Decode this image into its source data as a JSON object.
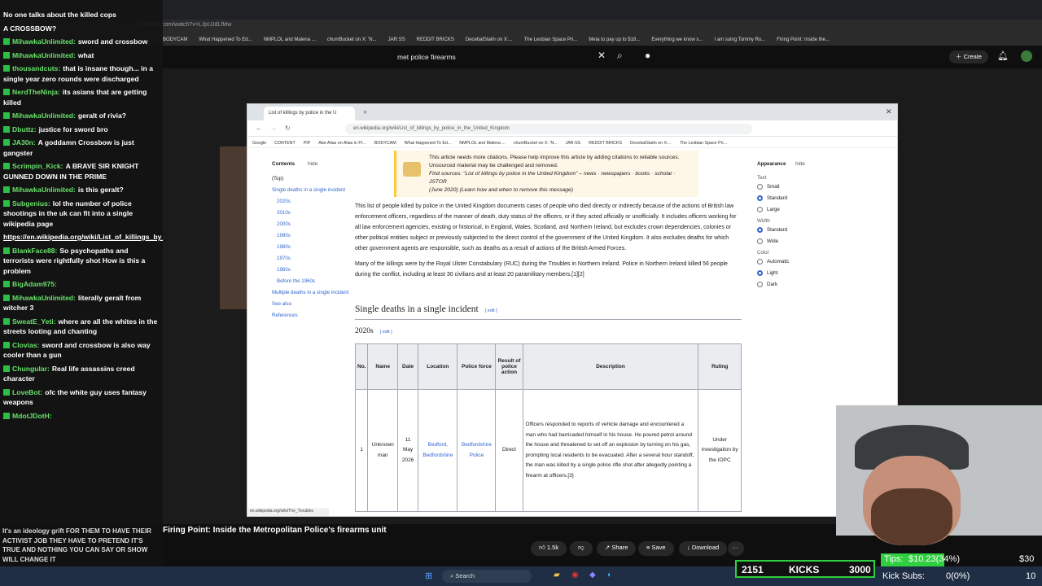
{
  "outer_browser": {
    "url": "youtube.com/watch?v=LJpUJdLfMw",
    "bookmarks": [
      "BODYCAM",
      "What Happened To Ed...",
      "NMPLOL and Malena ...",
      "chumBucket on X: 'N...",
      "JAR:SS",
      "REDDIT BRICKS",
      "DecebalStalin on X:...",
      "The Lesbian Space Pri...",
      "Meta to pay up to $18...",
      "Everything we know s...",
      "I am suing Tommy Ro...",
      "Firing Point: Inside the..."
    ]
  },
  "youtube": {
    "search_query": "met police firearms",
    "create_label": "Create",
    "video_title": "Firing Point: Inside the Metropolitan Police's firearms unit",
    "actions": {
      "likes": "1.5k",
      "share": "Share",
      "save": "Save",
      "download": "Download"
    }
  },
  "chat": {
    "messages": [
      {
        "user": "",
        "text": "No one talks about the killed cops"
      },
      {
        "user": "",
        "text": "A CROSSBOW?"
      },
      {
        "user": "MihawkaUnlimited:",
        "text": "sword and crossbow"
      },
      {
        "user": "MihawkaUnlimited:",
        "text": "what"
      },
      {
        "user": "thousandcuts:",
        "text": "that is insane though... in a single year zero rounds were discharged"
      },
      {
        "user": "NerdTheNinja:",
        "text": "its asians that are getting killed"
      },
      {
        "user": "MihawkaUnlimited:",
        "text": "geralt of rivia?"
      },
      {
        "user": "Dbuttz:",
        "text": "justice for sword bro"
      },
      {
        "user": "JA30n:",
        "text": "A goddamn Crossbow is just gangster"
      },
      {
        "user": "Scrimpin_Kick:",
        "text": "A BRAVE SIR KNIGHT GUNNED DOWN IN THE PRIME"
      },
      {
        "user": "MihawkaUnlimited:",
        "text": "is this geralt?"
      },
      {
        "user": "Subgenius:",
        "text": "lol the number of police shootings in the uk can fit into a single wikipedia page"
      },
      {
        "user": "",
        "text": "https://en.wikipedia.org/wiki/List_of_killings_by_police_in_the_United_Kingdom",
        "link": true
      },
      {
        "user": "BlankFace88:",
        "text": "So psychopaths and terrorists were rightfully shot How is this a problem"
      },
      {
        "user": "BigAdam975:",
        "text": ""
      },
      {
        "user": "MihawkaUnlimited:",
        "text": "literally geralt from witcher 3"
      },
      {
        "user": "SweatE_Yeti:",
        "text": "where are all the whites in the streets looting and chanting"
      },
      {
        "user": "Clovias:",
        "text": "sword and crossbow is also way cooler than a gun"
      },
      {
        "user": "Chungular:",
        "text": "Real life assassins creed character"
      },
      {
        "user": "LoveBot:",
        "text": "ofc the white guy uses fantasy weapons"
      },
      {
        "user": "MdotJDotH:",
        "text": ""
      }
    ],
    "bottom_text": "It's an ideology grift FOR THEM TO HAVE THEIR ACTIVIST JOB THEY HAVE TO PRETEND IT'S TRUE AND NOTHING YOU CAN SAY OR SHOW WILL CHANGE IT"
  },
  "inner_browser": {
    "tab_title": "List of killings by police in the U",
    "url": "en.wikipedia.org/wiki/List_of_killings_by_police_in_the_United_Kingdom",
    "bookmarks": [
      "Google",
      "CONTENT",
      "PIP",
      "Abe Alias on Alias in Pr...",
      "BODYCAM",
      "What Happened To Ed...",
      "NMPLOL and Malena ...",
      "chumBucket on X: 'N...",
      "JAR:SS",
      "REDDIT BRICKS",
      "DecebalStalin on X:...",
      "The Lesbian Space Pri..."
    ],
    "status_url": "en.wikipedia.org/wiki/The_Troubles"
  },
  "wiki": {
    "toc": {
      "title": "Contents",
      "hide": "hide",
      "top": "(Top)",
      "items": [
        "Single deaths in a single incident",
        "2020s",
        "2010s",
        "2000s",
        "1990s",
        "1980s",
        "1970s",
        "1960s",
        "Before the 1960s",
        "Multiple deaths in a single incident",
        "See also",
        "References"
      ]
    },
    "notice": {
      "line1": "This article needs more citations. Please help improve this article by adding citations to reliable sources. Unsourced material may be challenged and removed.",
      "line2": "Find sources: \"List of killings by police in the United Kingdom\" – news · newspapers · books · scholar · JSTOR",
      "line3": "(June 2020) (Learn how and when to remove this message)"
    },
    "intro1": "This list of people killed by police in the United Kingdom documents cases of people who died directly or indirectly because of the actions of British law enforcement officers, regardless of the manner of death, duty status of the officers, or if they acted officially or unofficially. It includes officers working for all law enforcement agencies, existing or historical, in England, Wales, Scotland, and Northern Ireland, but excludes crown dependencies, colonies or other political entities subject or previously subjected to the direct control of the government of the United Kingdom. It also excludes deaths for which other government agents are responsible, such as deaths as a result of actions of the British Armed Forces.",
    "intro2": "Many of the killings were by the Royal Ulster Constabulary (RUC) during the Troubles in Northern Ireland. Police in Northern Ireland killed 56 people during the conflict, including at least 30 civilians and at least 20 paramilitary members.[1][2]",
    "h_single": "Single deaths in a single incident",
    "h_2020s": "2020s",
    "edit": "[ edit ]",
    "table": {
      "headers": [
        "No.",
        "Name",
        "Date",
        "Location",
        "Police force",
        "Result of police action",
        "Description",
        "Ruling"
      ],
      "row": [
        "1",
        "Unknown man",
        "11 May 2026",
        "Bedford, Bedfordshire",
        "Bedfordshire Police",
        "Direct",
        "Officers responded to reports of vehicle damage and encountered a man who had barricaded himself in his house. He poured petrol around the house and threatened to set off an explosion by turning on his gas, prompting local residents to be evacuated. After a several hour standoff, the man was killed by a single police rifle shot after allegedly pointing a firearm at officers.[3]",
        "Under investigation by the IOPC"
      ]
    },
    "appearance": {
      "title": "Appearance",
      "hide": "hide",
      "text_label": "Text",
      "text_opts": [
        "Small",
        "Standard",
        "Large"
      ],
      "width_label": "Width",
      "width_opts": [
        "Standard",
        "Wide"
      ],
      "color_label": "Color",
      "color_opts": [
        "Automatic",
        "Light",
        "Dark"
      ]
    }
  },
  "taskbar": {
    "search": "Search"
  },
  "overlay": {
    "kicks_count": "2151",
    "kicks_label": "KICKS",
    "kicks_goal": "3000",
    "tips_label": "Tips:",
    "tips_value": "$10.23(34%)",
    "tips_goal": "$30",
    "subs_label": "Kick Subs:",
    "subs_value": "0(0%)",
    "subs_goal": "10"
  }
}
